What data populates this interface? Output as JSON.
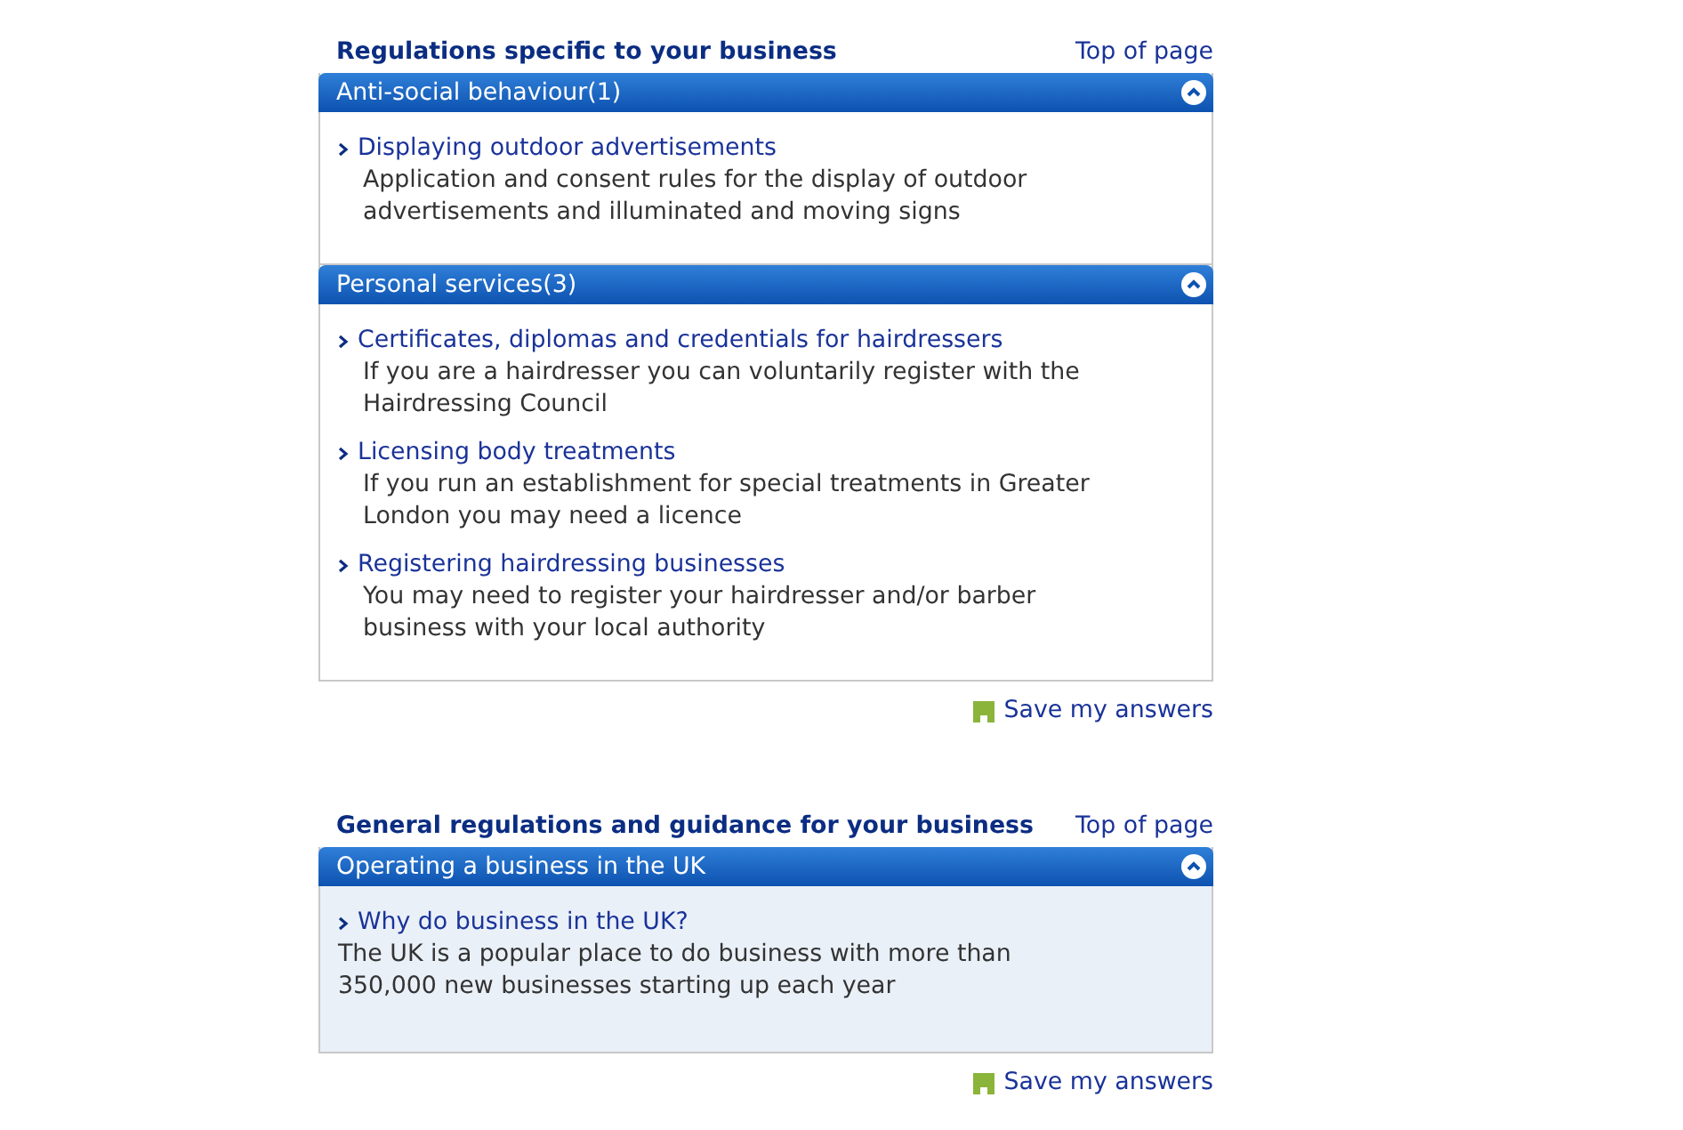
{
  "sections": [
    {
      "title": "Regulations specific to your business",
      "top_link": "Top of page",
      "save_link": "Save my answers",
      "panels": [
        {
          "kind": "standard",
          "title": "Anti-social behaviour(1)",
          "expanded": true,
          "items": [
            {
              "link": "Displaying outdoor advertisements",
              "description": "Application and consent rules for the display of outdoor advertisements and illuminated and moving signs"
            }
          ]
        },
        {
          "kind": "standard",
          "title": "Personal services(3)",
          "expanded": true,
          "items": [
            {
              "link": "Certificates, diplomas and credentials for hairdressers",
              "description": "If you are a hairdresser you can voluntarily register with the Hairdressing Council"
            },
            {
              "link": "Licensing body treatments",
              "description": "If you run an establishment for special treatments in Greater London you may need a licence"
            },
            {
              "link": "Registering hairdressing businesses",
              "description": "You may need to register your hairdresser and/or barber business with your local authority"
            }
          ]
        }
      ]
    },
    {
      "title": "General regulations and guidance for your business",
      "top_link": "Top of page",
      "save_link": "Save my answers",
      "panels": [
        {
          "kind": "featured",
          "title": "Operating a business in the UK",
          "expanded": true,
          "items": [
            {
              "link": "Why do business in the UK?",
              "description": "The UK is a popular place to do business with more than 350,000 new businesses starting up each year"
            }
          ]
        }
      ]
    }
  ]
}
